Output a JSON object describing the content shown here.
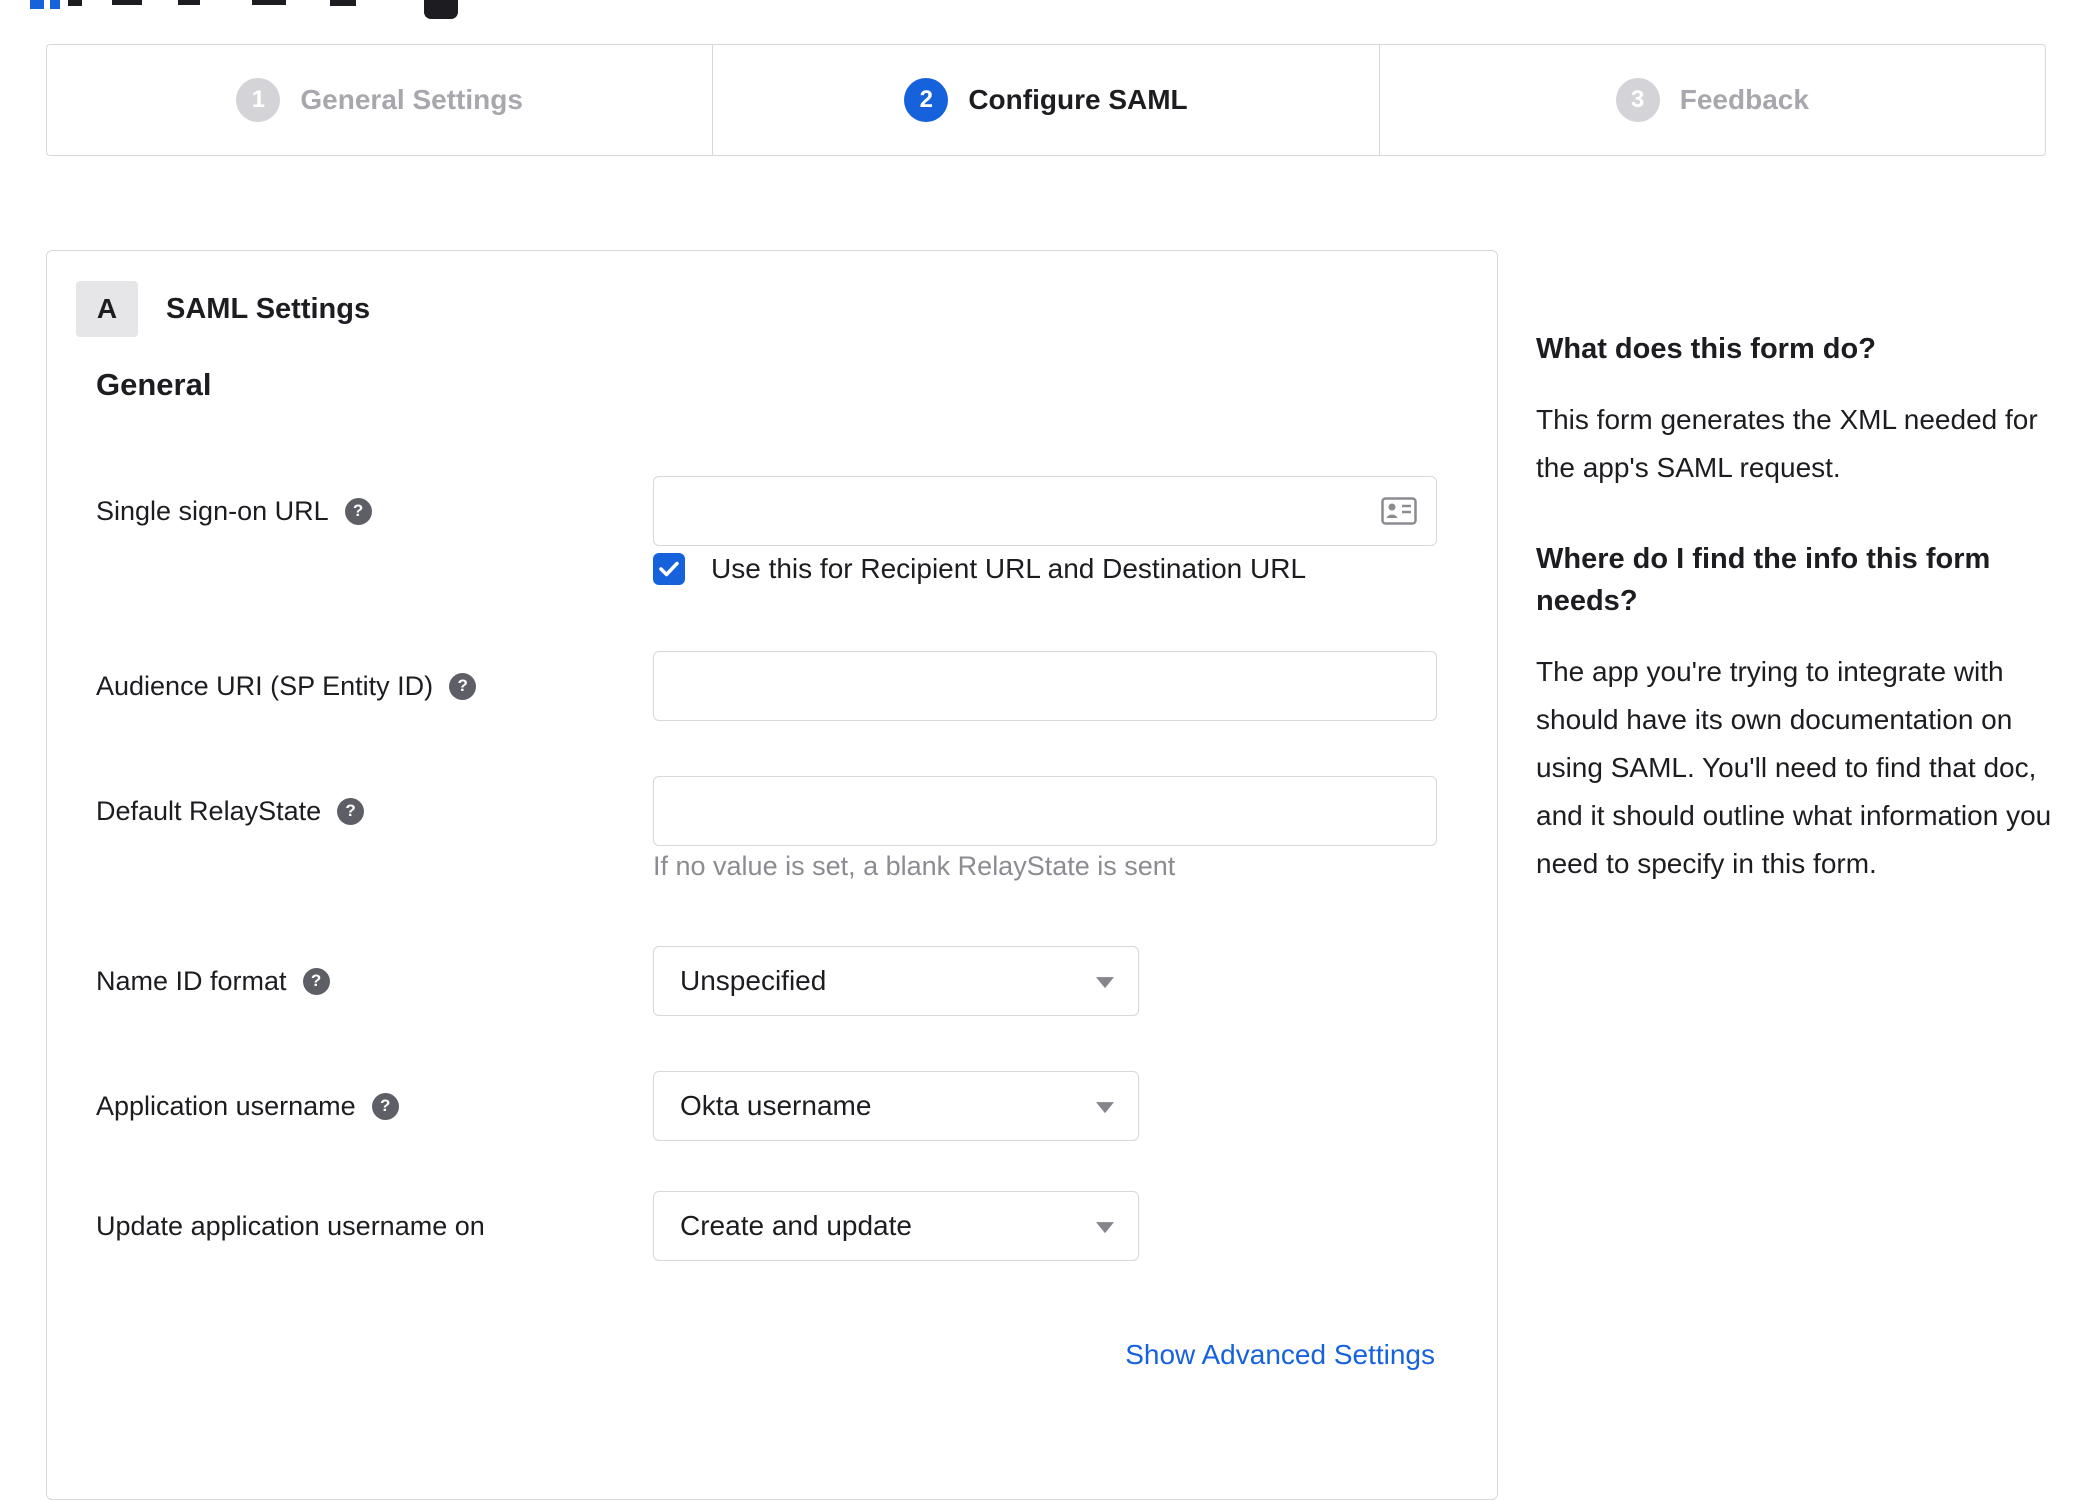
{
  "stepper": {
    "steps": [
      {
        "number": "1",
        "label": "General Settings",
        "state": "inactive"
      },
      {
        "number": "2",
        "label": "Configure SAML",
        "state": "active"
      },
      {
        "number": "3",
        "label": "Feedback",
        "state": "inactive"
      }
    ]
  },
  "panel": {
    "section_badge": "A",
    "section_title": "SAML Settings",
    "group_title": "General",
    "fields": {
      "sso_url": {
        "label": "Single sign-on URL",
        "value": ""
      },
      "sso_checkbox": {
        "label": "Use this for Recipient URL and Destination URL",
        "checked": true
      },
      "audience_uri": {
        "label": "Audience URI (SP Entity ID)",
        "value": ""
      },
      "relay_state": {
        "label": "Default RelayState",
        "value": "",
        "hint": "If no value is set, a blank RelayState is sent"
      },
      "name_id_format": {
        "label": "Name ID format",
        "value": "Unspecified"
      },
      "app_username": {
        "label": "Application username",
        "value": "Okta username"
      },
      "update_username": {
        "label": "Update application username on",
        "value": "Create and update"
      }
    },
    "advanced_link": "Show Advanced Settings"
  },
  "help_panel": {
    "q1": "What does this form do?",
    "a1": "This form generates the XML needed for the app's SAML request.",
    "q2": "Where do I find the info this form needs?",
    "a2": "The app you're trying to integrate with should have its own documentation on using SAML. You'll need to find that doc, and it should outline what information you need to specify in this form."
  },
  "icons": {
    "help": "?"
  },
  "colors": {
    "accent": "#1662dd",
    "inactive_gray": "#d3d3d8",
    "border": "#d7d7dc",
    "text": "#1d1d21",
    "muted": "#8b8b91"
  }
}
